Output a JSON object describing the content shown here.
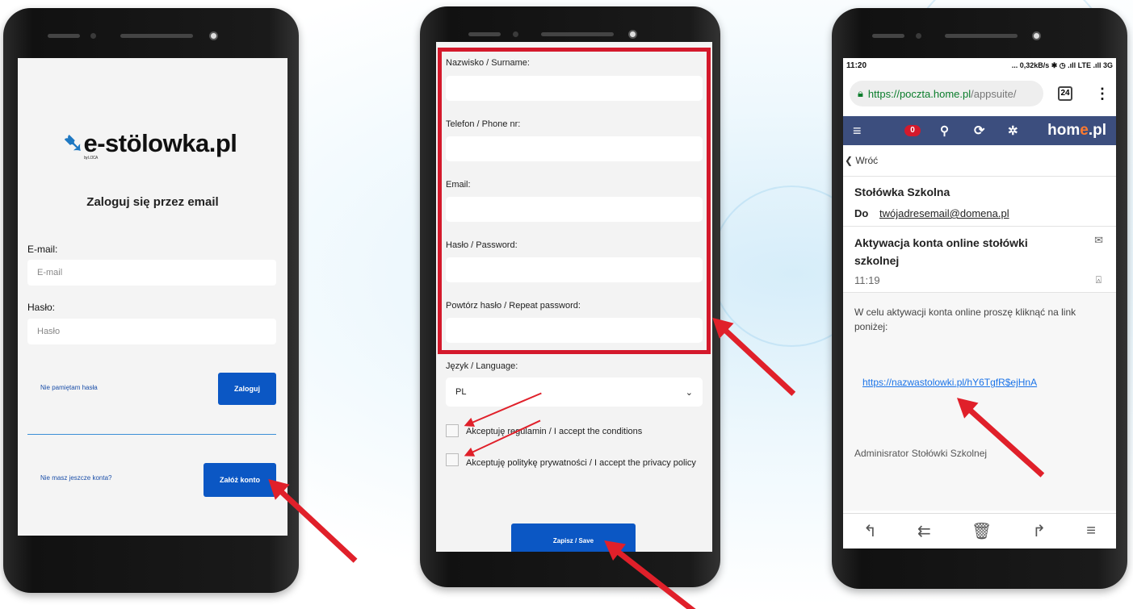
{
  "screen1": {
    "logo_text": "e-st",
    "logo_o": "ö",
    "logo_text2": "lowka.pl",
    "logo_by": "by LOCA",
    "title": "Zaloguj się przez email",
    "email_label": "E-mail:",
    "email_placeholder": "E-mail",
    "password_label": "Hasło:",
    "password_placeholder": "Hasło",
    "forgot_link": "Nie pamiętam hasła",
    "login_button": "Zaloguj",
    "no_account_link": "Nie masz jeszcze konta?",
    "register_button": "Załóż konto"
  },
  "screen2": {
    "surname_label": "Nazwisko / Surname:",
    "phone_label": "Telefon / Phone nr:",
    "email_label": "Email:",
    "password_label": "Hasło / Password:",
    "repeat_label": "Powtórz hasło / Repeat password:",
    "language_label": "Język / Language:",
    "language_value": "PL",
    "accept_terms": "Akceptuję regulamin / I accept the conditions",
    "accept_privacy": "Akceptuję politykę prywatności / I accept the privacy policy",
    "save_button": "Zapisz / Save"
  },
  "screen3": {
    "time": "11:20",
    "status_right": "... 0,32kB/s ✱ ◷ .ıll LTE .ıll 3G",
    "url_host": "https://poczta.home.pl",
    "url_path": "/appsuite/",
    "tab_count": "24",
    "unread_badge": "0",
    "brand_a": "hom",
    "brand_b": "e",
    "brand_c": ".pl",
    "back_label": "Wróć",
    "sender": "Stołówka Szkolna",
    "to_label": "Do",
    "to_address": "twójadresemail@domena.pl",
    "subject": "Aktywacja konta online stołówki szkolnej",
    "subject_time": "11:19",
    "body": "W celu aktywacji konta online proszę kliknąć na link poniżej:",
    "activation_link": "https://nazwastolowki.pl/hY6TgfR$ejHnA",
    "signature": "Adminisrator Stołówki Szkolnej"
  },
  "colors": {
    "primary_blue": "#0b57c4",
    "highlight_red": "#d4192c",
    "toolbar": "#3c4e7e",
    "badge": "#d4192c",
    "brand_accent": "#ff7a2f"
  }
}
